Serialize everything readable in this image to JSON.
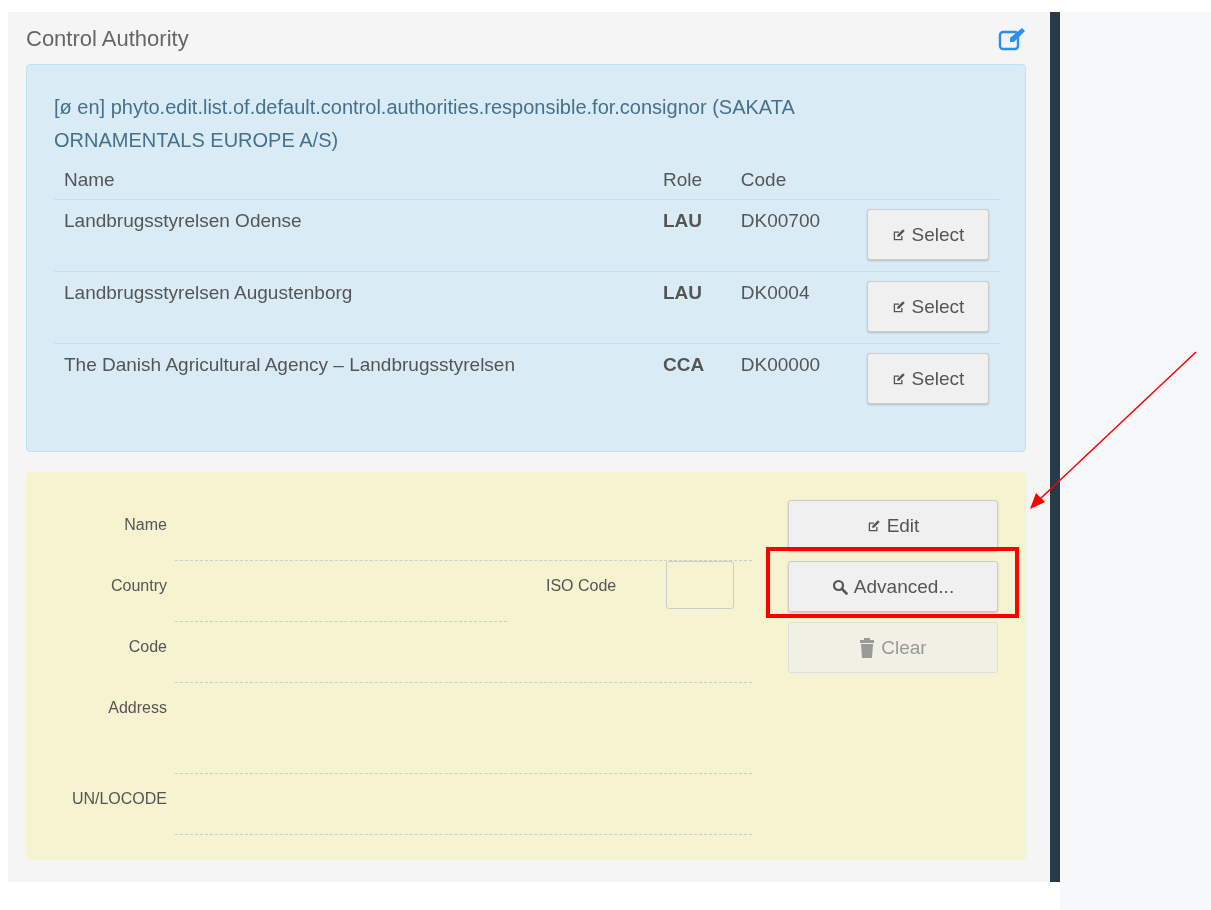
{
  "panel": {
    "title": "Control Authority"
  },
  "defaults": {
    "heading": "[ø en] phyto.edit.list.of.default.control.authorities.responsible.for.consignor (SAKATA ORNAMENTALS EUROPE A/S)",
    "columns": [
      "Name",
      "Role",
      "Code"
    ],
    "rows": [
      {
        "name": "Landbrugsstyrelsen Odense",
        "role": "LAU",
        "code": "DK00700",
        "action": "Select"
      },
      {
        "name": "Landbrugsstyrelsen Augustenborg",
        "role": "LAU",
        "code": "DK0004",
        "action": "Select"
      },
      {
        "name": "The Danish Agricultural Agency – Landbrugsstyrelsen",
        "role": "CCA",
        "code": "DK00000",
        "action": "Select"
      }
    ]
  },
  "form": {
    "fields": [
      {
        "kind": "line",
        "label": "Name"
      },
      {
        "kind": "iso",
        "label": "Country",
        "iso_label": "ISO Code"
      },
      {
        "kind": "line",
        "label": "Code"
      },
      {
        "kind": "tall",
        "label": "Address"
      },
      {
        "kind": "line",
        "label": "UN/LOCODE"
      }
    ],
    "buttons": [
      {
        "kind": "edit",
        "label": "Edit",
        "disabled": false,
        "annotated": false
      },
      {
        "kind": "search",
        "label": "Advanced...",
        "disabled": false,
        "annotated": true
      },
      {
        "kind": "delete",
        "label": "Clear",
        "disabled": true,
        "annotated": false
      }
    ]
  }
}
